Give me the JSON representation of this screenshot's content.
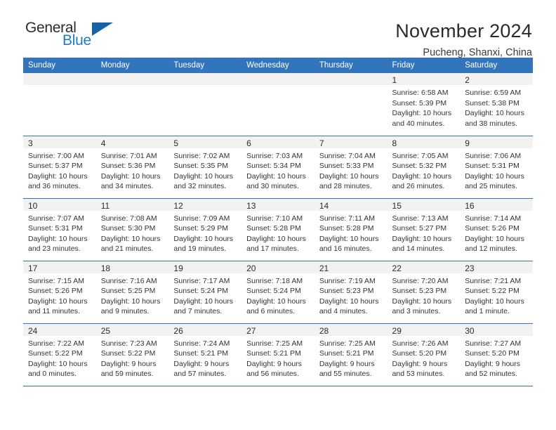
{
  "logo": {
    "primary_text": "General",
    "secondary_text": "Blue",
    "primary_color": "#2b2b2b",
    "secondary_color": "#1f7bc1",
    "triangle_color": "#1464a5"
  },
  "header": {
    "title": "November 2024",
    "subtitle": "Pucheng, Shanxi, China"
  },
  "theme": {
    "header_bg": "#3275bc",
    "header_text": "#ffffff",
    "daynum_band_bg": "#f2f2f2",
    "row_divider": "#3275bc"
  },
  "calendar": {
    "weekday_headers": [
      "Sunday",
      "Monday",
      "Tuesday",
      "Wednesday",
      "Thursday",
      "Friday",
      "Saturday"
    ],
    "weeks": [
      [
        {
          "day": "",
          "sunrise": "",
          "sunset": "",
          "daylight_line1": "",
          "daylight_line2": ""
        },
        {
          "day": "",
          "sunrise": "",
          "sunset": "",
          "daylight_line1": "",
          "daylight_line2": ""
        },
        {
          "day": "",
          "sunrise": "",
          "sunset": "",
          "daylight_line1": "",
          "daylight_line2": ""
        },
        {
          "day": "",
          "sunrise": "",
          "sunset": "",
          "daylight_line1": "",
          "daylight_line2": ""
        },
        {
          "day": "",
          "sunrise": "",
          "sunset": "",
          "daylight_line1": "",
          "daylight_line2": ""
        },
        {
          "day": "1",
          "sunrise": "Sunrise: 6:58 AM",
          "sunset": "Sunset: 5:39 PM",
          "daylight_line1": "Daylight: 10 hours",
          "daylight_line2": "and 40 minutes."
        },
        {
          "day": "2",
          "sunrise": "Sunrise: 6:59 AM",
          "sunset": "Sunset: 5:38 PM",
          "daylight_line1": "Daylight: 10 hours",
          "daylight_line2": "and 38 minutes."
        }
      ],
      [
        {
          "day": "3",
          "sunrise": "Sunrise: 7:00 AM",
          "sunset": "Sunset: 5:37 PM",
          "daylight_line1": "Daylight: 10 hours",
          "daylight_line2": "and 36 minutes."
        },
        {
          "day": "4",
          "sunrise": "Sunrise: 7:01 AM",
          "sunset": "Sunset: 5:36 PM",
          "daylight_line1": "Daylight: 10 hours",
          "daylight_line2": "and 34 minutes."
        },
        {
          "day": "5",
          "sunrise": "Sunrise: 7:02 AM",
          "sunset": "Sunset: 5:35 PM",
          "daylight_line1": "Daylight: 10 hours",
          "daylight_line2": "and 32 minutes."
        },
        {
          "day": "6",
          "sunrise": "Sunrise: 7:03 AM",
          "sunset": "Sunset: 5:34 PM",
          "daylight_line1": "Daylight: 10 hours",
          "daylight_line2": "and 30 minutes."
        },
        {
          "day": "7",
          "sunrise": "Sunrise: 7:04 AM",
          "sunset": "Sunset: 5:33 PM",
          "daylight_line1": "Daylight: 10 hours",
          "daylight_line2": "and 28 minutes."
        },
        {
          "day": "8",
          "sunrise": "Sunrise: 7:05 AM",
          "sunset": "Sunset: 5:32 PM",
          "daylight_line1": "Daylight: 10 hours",
          "daylight_line2": "and 26 minutes."
        },
        {
          "day": "9",
          "sunrise": "Sunrise: 7:06 AM",
          "sunset": "Sunset: 5:31 PM",
          "daylight_line1": "Daylight: 10 hours",
          "daylight_line2": "and 25 minutes."
        }
      ],
      [
        {
          "day": "10",
          "sunrise": "Sunrise: 7:07 AM",
          "sunset": "Sunset: 5:31 PM",
          "daylight_line1": "Daylight: 10 hours",
          "daylight_line2": "and 23 minutes."
        },
        {
          "day": "11",
          "sunrise": "Sunrise: 7:08 AM",
          "sunset": "Sunset: 5:30 PM",
          "daylight_line1": "Daylight: 10 hours",
          "daylight_line2": "and 21 minutes."
        },
        {
          "day": "12",
          "sunrise": "Sunrise: 7:09 AM",
          "sunset": "Sunset: 5:29 PM",
          "daylight_line1": "Daylight: 10 hours",
          "daylight_line2": "and 19 minutes."
        },
        {
          "day": "13",
          "sunrise": "Sunrise: 7:10 AM",
          "sunset": "Sunset: 5:28 PM",
          "daylight_line1": "Daylight: 10 hours",
          "daylight_line2": "and 17 minutes."
        },
        {
          "day": "14",
          "sunrise": "Sunrise: 7:11 AM",
          "sunset": "Sunset: 5:28 PM",
          "daylight_line1": "Daylight: 10 hours",
          "daylight_line2": "and 16 minutes."
        },
        {
          "day": "15",
          "sunrise": "Sunrise: 7:13 AM",
          "sunset": "Sunset: 5:27 PM",
          "daylight_line1": "Daylight: 10 hours",
          "daylight_line2": "and 14 minutes."
        },
        {
          "day": "16",
          "sunrise": "Sunrise: 7:14 AM",
          "sunset": "Sunset: 5:26 PM",
          "daylight_line1": "Daylight: 10 hours",
          "daylight_line2": "and 12 minutes."
        }
      ],
      [
        {
          "day": "17",
          "sunrise": "Sunrise: 7:15 AM",
          "sunset": "Sunset: 5:26 PM",
          "daylight_line1": "Daylight: 10 hours",
          "daylight_line2": "and 11 minutes."
        },
        {
          "day": "18",
          "sunrise": "Sunrise: 7:16 AM",
          "sunset": "Sunset: 5:25 PM",
          "daylight_line1": "Daylight: 10 hours",
          "daylight_line2": "and 9 minutes."
        },
        {
          "day": "19",
          "sunrise": "Sunrise: 7:17 AM",
          "sunset": "Sunset: 5:24 PM",
          "daylight_line1": "Daylight: 10 hours",
          "daylight_line2": "and 7 minutes."
        },
        {
          "day": "20",
          "sunrise": "Sunrise: 7:18 AM",
          "sunset": "Sunset: 5:24 PM",
          "daylight_line1": "Daylight: 10 hours",
          "daylight_line2": "and 6 minutes."
        },
        {
          "day": "21",
          "sunrise": "Sunrise: 7:19 AM",
          "sunset": "Sunset: 5:23 PM",
          "daylight_line1": "Daylight: 10 hours",
          "daylight_line2": "and 4 minutes."
        },
        {
          "day": "22",
          "sunrise": "Sunrise: 7:20 AM",
          "sunset": "Sunset: 5:23 PM",
          "daylight_line1": "Daylight: 10 hours",
          "daylight_line2": "and 3 minutes."
        },
        {
          "day": "23",
          "sunrise": "Sunrise: 7:21 AM",
          "sunset": "Sunset: 5:22 PM",
          "daylight_line1": "Daylight: 10 hours",
          "daylight_line2": "and 1 minute."
        }
      ],
      [
        {
          "day": "24",
          "sunrise": "Sunrise: 7:22 AM",
          "sunset": "Sunset: 5:22 PM",
          "daylight_line1": "Daylight: 10 hours",
          "daylight_line2": "and 0 minutes."
        },
        {
          "day": "25",
          "sunrise": "Sunrise: 7:23 AM",
          "sunset": "Sunset: 5:22 PM",
          "daylight_line1": "Daylight: 9 hours",
          "daylight_line2": "and 59 minutes."
        },
        {
          "day": "26",
          "sunrise": "Sunrise: 7:24 AM",
          "sunset": "Sunset: 5:21 PM",
          "daylight_line1": "Daylight: 9 hours",
          "daylight_line2": "and 57 minutes."
        },
        {
          "day": "27",
          "sunrise": "Sunrise: 7:25 AM",
          "sunset": "Sunset: 5:21 PM",
          "daylight_line1": "Daylight: 9 hours",
          "daylight_line2": "and 56 minutes."
        },
        {
          "day": "28",
          "sunrise": "Sunrise: 7:25 AM",
          "sunset": "Sunset: 5:21 PM",
          "daylight_line1": "Daylight: 9 hours",
          "daylight_line2": "and 55 minutes."
        },
        {
          "day": "29",
          "sunrise": "Sunrise: 7:26 AM",
          "sunset": "Sunset: 5:20 PM",
          "daylight_line1": "Daylight: 9 hours",
          "daylight_line2": "and 53 minutes."
        },
        {
          "day": "30",
          "sunrise": "Sunrise: 7:27 AM",
          "sunset": "Sunset: 5:20 PM",
          "daylight_line1": "Daylight: 9 hours",
          "daylight_line2": "and 52 minutes."
        }
      ]
    ]
  }
}
